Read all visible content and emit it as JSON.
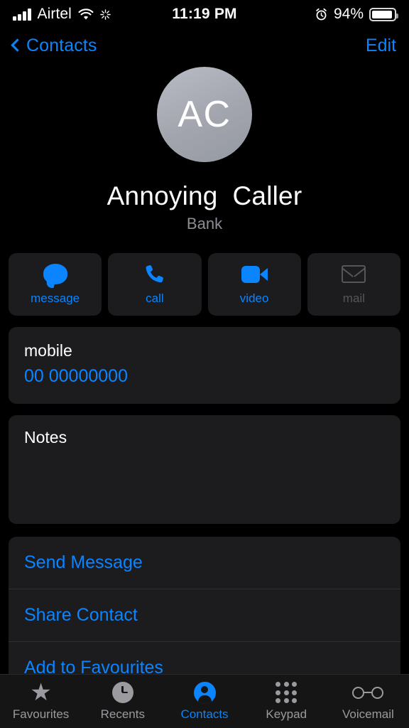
{
  "status_bar": {
    "carrier": "Airtel",
    "time": "11:19 PM",
    "battery_percent": "94%",
    "signal_icon": "signal-bars-icon",
    "wifi_icon": "wifi-icon",
    "activity_icon": "activity-spinner-icon",
    "alarm_icon": "alarm-clock-icon",
    "battery_icon": "battery-full-icon"
  },
  "nav": {
    "back_label": "Contacts",
    "back_icon": "chevron-left-icon",
    "edit_label": "Edit"
  },
  "contact": {
    "initials": "AC",
    "name": "Annoying  Caller",
    "organization": "Bank"
  },
  "actions": [
    {
      "label": "message",
      "icon": "message-bubble-icon",
      "enabled": true
    },
    {
      "label": "call",
      "icon": "phone-handset-icon",
      "enabled": true
    },
    {
      "label": "video",
      "icon": "video-camera-icon",
      "enabled": true
    },
    {
      "label": "mail",
      "icon": "envelope-icon",
      "enabled": false
    }
  ],
  "phone_field": {
    "label": "mobile",
    "value": "00 00000000"
  },
  "notes": {
    "label": "Notes",
    "value": ""
  },
  "list_actions": [
    {
      "label": "Send Message"
    },
    {
      "label": "Share Contact"
    },
    {
      "label": "Add to Favourites"
    }
  ],
  "tabs": [
    {
      "label": "Favourites",
      "icon": "star-icon",
      "active": false
    },
    {
      "label": "Recents",
      "icon": "clock-icon",
      "active": false
    },
    {
      "label": "Contacts",
      "icon": "person-circle-icon",
      "active": true
    },
    {
      "label": "Keypad",
      "icon": "keypad-dots-icon",
      "active": false
    },
    {
      "label": "Voicemail",
      "icon": "voicemail-icon",
      "active": false
    }
  ],
  "colors": {
    "accent": "#0a84ff",
    "background": "#000000",
    "card": "#1c1c1e",
    "disabled": "#55555a",
    "secondary_text": "#8d8d93"
  }
}
